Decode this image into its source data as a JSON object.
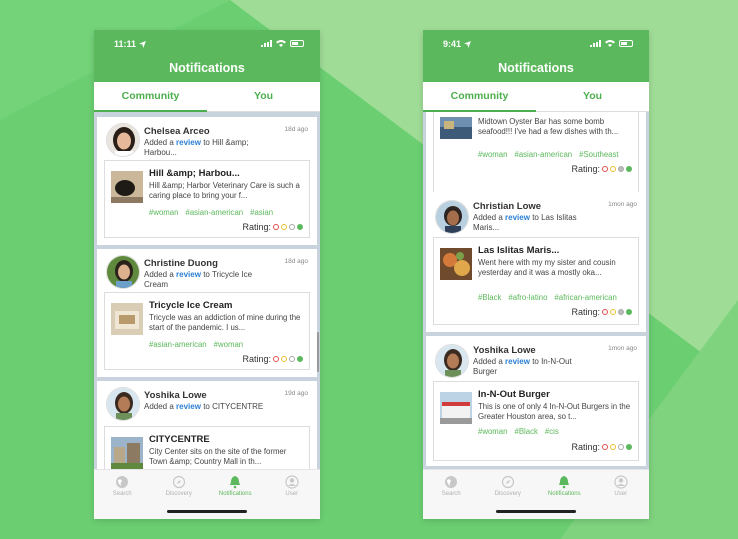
{
  "screen_left": {
    "status_time": "11:11",
    "title": "Notifications",
    "tabs": [
      "Community",
      "You"
    ],
    "cards": [
      {
        "name": "Chelsea Arceo",
        "action_prefix": "Added a",
        "action_link": "review",
        "action_suffix": "to Hill &amp; Harbou...",
        "ago": "18d ago",
        "item_title": "Hill &amp; Harbou...",
        "item_desc": "Hill &amp; Harbor Veterinary Care is such a caring place to bring your f...",
        "tags": [
          "#woman",
          "#asian-american",
          "#asian"
        ],
        "rating_label": "Rating:",
        "rating_level": 4
      },
      {
        "name": "Christine Duong",
        "action_prefix": "Added a",
        "action_link": "review",
        "action_suffix": "to Tricycle Ice Cream",
        "ago": "18d ago",
        "item_title": "Tricycle Ice Cream",
        "item_desc": "Tricycle was an addiction of mine during the start of the pandemic. I us...",
        "tags": [
          "#asian-american",
          "#woman"
        ],
        "rating_label": "Rating:",
        "rating_level": 4
      },
      {
        "name": "Yoshika Lowe",
        "action_prefix": "Added a",
        "action_link": "review",
        "action_suffix": "to CITYCENTRE",
        "ago": "19d ago",
        "item_title": "CITYCENTRE",
        "item_desc": "City Center sits on the site of the former Town &amp; Country Mall in th..."
      }
    ],
    "nav": [
      "Search",
      "Discovery",
      "Notifications",
      "User"
    ]
  },
  "screen_right": {
    "status_time": "9:41",
    "title": "Notifications",
    "tabs": [
      "Community",
      "You"
    ],
    "cards": [
      {
        "item_desc": "Midtown Oyster Bar has some bomb seafood!!! I've had a few dishes with th...",
        "tags": [
          "#woman",
          "#asian-american",
          "#Southeast"
        ],
        "rating_label": "Rating:",
        "rating_level": 3
      },
      {
        "name": "Christian Lowe",
        "action_prefix": "Added a",
        "action_link": "review",
        "action_suffix": "to Las Islitas Maris...",
        "ago": "1mon ago",
        "item_title": "Las Islitas Maris...",
        "item_desc": "Went here with my my sister and cousin yesterday and it was a mostly oka...",
        "tags": [
          "#Black",
          "#afro-latino",
          "#african-american"
        ],
        "rating_label": "Rating:",
        "rating_level": 3
      },
      {
        "name": "Yoshika Lowe",
        "action_prefix": "Added a",
        "action_link": "review",
        "action_suffix": "to In-N-Out Burger",
        "ago": "1mon ago",
        "item_title": "In-N-Out Burger",
        "item_desc": "This is one of only 4 In-N-Out Burgers in the Greater Houston area, so t...",
        "tags": [
          "#woman",
          "#Black",
          "#cis"
        ],
        "rating_label": "Rating:",
        "rating_level": 4
      }
    ],
    "nav": [
      "Search",
      "Discovery",
      "Notifications",
      "User"
    ]
  },
  "colors": {
    "brand_green": "#5cb85c",
    "link_blue": "#2a7fd4"
  }
}
